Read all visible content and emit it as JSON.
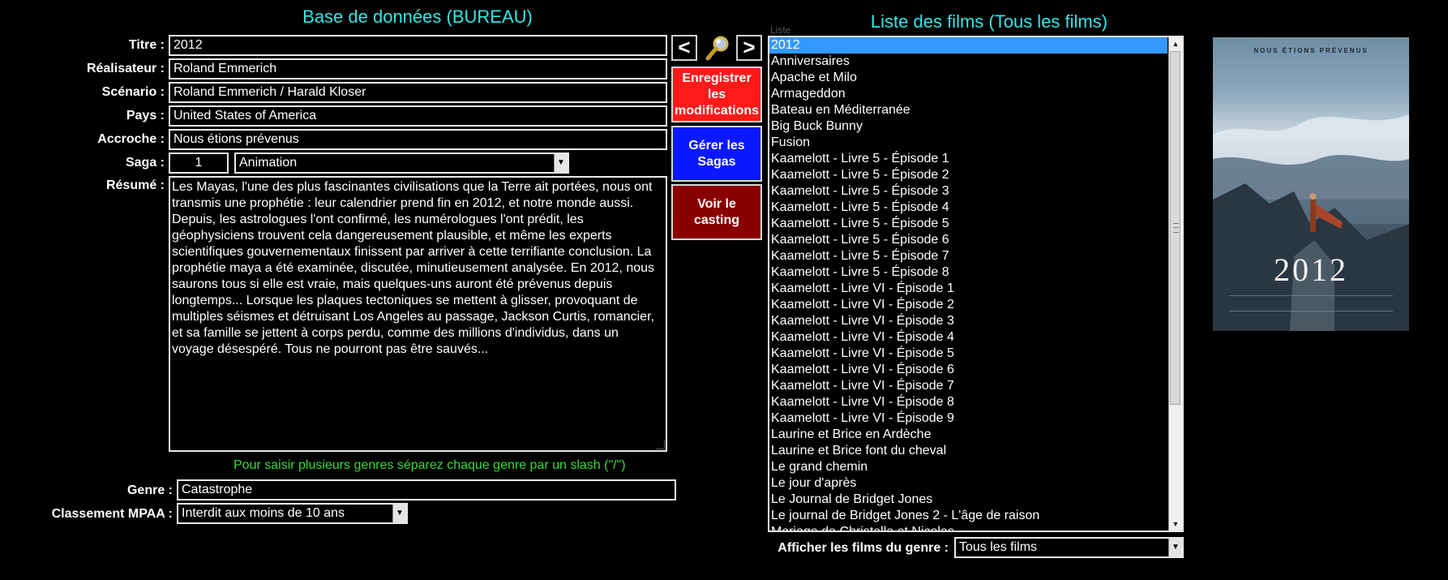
{
  "headings": {
    "left": "Base de données (BUREAU)",
    "right": "Liste des films (Tous les films)"
  },
  "form": {
    "titre_label": "Titre :",
    "titre": "2012",
    "realisateur_label": "Réalisateur :",
    "realisateur": "Roland Emmerich",
    "scenario_label": "Scénario :",
    "scenario": "Roland Emmerich / Harald Kloser",
    "pays_label": "Pays :",
    "pays": "United States of America",
    "accroche_label": "Accroche :",
    "accroche": "Nous étions prévenus",
    "saga_label": "Saga :",
    "saga_number": "1",
    "saga_select": "Animation",
    "resume_label": "Résumé :",
    "resume": "Les Mayas, l'une des plus fascinantes civilisations que la Terre ait portées, nous ont transmis une prophétie : leur calendrier prend fin en 2012, et notre monde aussi. Depuis, les astrologues l'ont confirmé, les numérologues l'ont prédit, les géophysiciens trouvent cela dangereusement plausible, et même les experts scientifiques gouvernementaux finissent par arriver à cette terrifiante conclusion. La prophétie maya a été examinée, discutée, minutieusement analysée. En 2012, nous saurons tous si elle est vraie, mais quelques-uns auront été prévenus depuis longtemps... Lorsque les plaques tectoniques se mettent à glisser, provoquant de multiples séismes et détruisant Los Angeles au passage, Jackson Curtis, romancier, et sa famille se jettent à corps perdu, comme des millions d'individus, dans un voyage désespéré. Tous ne pourront pas être sauvés...",
    "hint": "Pour saisir plusieurs genres séparez chaque genre par un slash (\"/\")",
    "genre_label": "Genre :",
    "genre": "Catastrophe",
    "mpaa_label": "Classement MPAA :",
    "mpaa": "Interdit aux moins de 10 ans"
  },
  "nav": {
    "prev": "<",
    "next": ">",
    "search_icon": "magnifier-icon"
  },
  "buttons": {
    "save": "Enregistrer les modifications",
    "sagas": "Gérer les Sagas",
    "casting": "Voir le casting"
  },
  "colors": {
    "save": "#ff1a1a",
    "sagas": "#0a18ff",
    "casting": "#8a0000",
    "heading": "#33e6e6",
    "hint": "#33dd33",
    "selection": "#3399ff"
  },
  "list": {
    "ghost_label": "Liste",
    "selected_index": 0,
    "items": [
      "2012",
      "Anniversaires",
      "Apache et Milo",
      "Armageddon",
      "Bateau en Méditerranée",
      "Big Buck Bunny",
      "Fusion",
      "Kaamelott - Livre 5 - Épisode 1",
      "Kaamelott - Livre 5 - Épisode 2",
      "Kaamelott - Livre 5 - Épisode 3",
      "Kaamelott - Livre 5 - Épisode 4",
      "Kaamelott - Livre 5 - Épisode 5",
      "Kaamelott - Livre 5 - Épisode 6",
      "Kaamelott - Livre 5 - Épisode 7",
      "Kaamelott - Livre 5 - Épisode 8",
      "Kaamelott - Livre VI - Épisode 1",
      "Kaamelott - Livre VI - Épisode 2",
      "Kaamelott - Livre VI - Épisode 3",
      "Kaamelott - Livre VI - Épisode 4",
      "Kaamelott - Livre VI - Épisode 5",
      "Kaamelott - Livre VI - Épisode 6",
      "Kaamelott - Livre VI - Épisode 7",
      "Kaamelott - Livre VI - Épisode 8",
      "Kaamelott - Livre VI - Épisode 9",
      "Laurine et Brice en Ardèche",
      "Laurine et Brice font du cheval",
      "Le grand chemin",
      "Le jour d'après",
      "Le Journal de Bridget Jones",
      "Le journal de Bridget Jones 2 - L'âge de raison",
      "Mariage de Christelle et Nicolas"
    ],
    "filter_label": "Afficher les films du genre :",
    "filter_value": "Tous les films"
  },
  "poster": {
    "tagline": "NOUS ÉTIONS PRÉVENUS",
    "title": "2012"
  }
}
